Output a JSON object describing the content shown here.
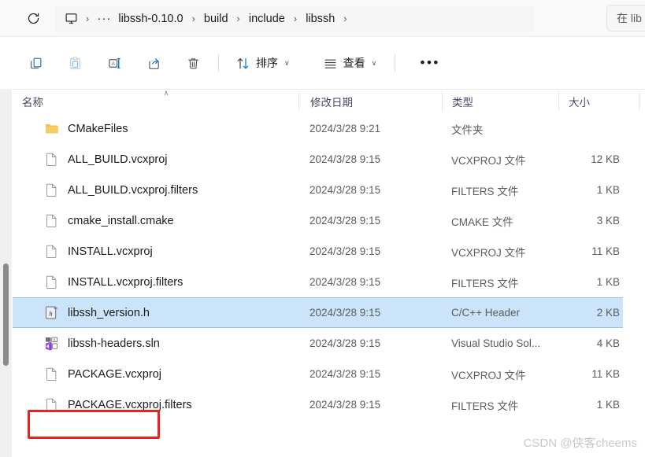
{
  "addressbar": {
    "refresh_icon": "refresh-icon",
    "pc_icon": "this-pc-icon",
    "overflow_label": "···",
    "separator": "›",
    "crumbs": [
      "libssh-0.10.0",
      "build",
      "include",
      "libssh"
    ],
    "trailing_separator": "›",
    "search_placeholder": "在 lib"
  },
  "toolbar": {
    "icon_buttons": [
      {
        "name": "copy-icon",
        "title": "复制"
      },
      {
        "name": "paste-icon",
        "title": "粘贴"
      },
      {
        "name": "rename-icon",
        "title": "重命名"
      },
      {
        "name": "share-icon",
        "title": "共享"
      },
      {
        "name": "delete-icon",
        "title": "删除"
      }
    ],
    "sort_label": "排序",
    "sort_icon": "sort-arrows-icon",
    "view_label": "查看",
    "view_icon": "view-list-icon",
    "more_label": "•••",
    "chevron": "∨"
  },
  "columns": {
    "name": "名称",
    "date": "修改日期",
    "type": "类型",
    "size": "大小",
    "sort_caret": "∧"
  },
  "files": [
    {
      "name": "CMakeFiles",
      "date": "2024/3/28 9:21",
      "type": "文件夹",
      "size": "",
      "icon": "folder-icon",
      "selected": false
    },
    {
      "name": "ALL_BUILD.vcxproj",
      "date": "2024/3/28 9:15",
      "type": "VCXPROJ 文件",
      "size": "12 KB",
      "icon": "file-icon",
      "selected": false
    },
    {
      "name": "ALL_BUILD.vcxproj.filters",
      "date": "2024/3/28 9:15",
      "type": "FILTERS 文件",
      "size": "1 KB",
      "icon": "file-icon",
      "selected": false
    },
    {
      "name": "cmake_install.cmake",
      "date": "2024/3/28 9:15",
      "type": "CMAKE 文件",
      "size": "3 KB",
      "icon": "file-icon",
      "selected": false
    },
    {
      "name": "INSTALL.vcxproj",
      "date": "2024/3/28 9:15",
      "type": "VCXPROJ 文件",
      "size": "11 KB",
      "icon": "file-icon",
      "selected": false
    },
    {
      "name": "INSTALL.vcxproj.filters",
      "date": "2024/3/28 9:15",
      "type": "FILTERS 文件",
      "size": "1 KB",
      "icon": "file-icon",
      "selected": false
    },
    {
      "name": "libssh_version.h",
      "date": "2024/3/28 9:15",
      "type": "C/C++ Header",
      "size": "2 KB",
      "icon": "cpp-header-icon",
      "selected": true
    },
    {
      "name": "libssh-headers.sln",
      "date": "2024/3/28 9:15",
      "type": "Visual Studio Sol...",
      "size": "4 KB",
      "icon": "vs-solution-icon",
      "selected": false
    },
    {
      "name": "PACKAGE.vcxproj",
      "date": "2024/3/28 9:15",
      "type": "VCXPROJ 文件",
      "size": "11 KB",
      "icon": "file-icon",
      "selected": false
    },
    {
      "name": "PACKAGE.vcxproj.filters",
      "date": "2024/3/28 9:15",
      "type": "FILTERS 文件",
      "size": "1 KB",
      "icon": "file-icon",
      "selected": false
    }
  ],
  "annotation": {
    "shape": "rectangle",
    "color": "#f02020",
    "target": "libssh_version.h"
  },
  "watermark": "CSDN @侠客cheems",
  "colors": {
    "selection_fill": "#cbe4f9",
    "selection_border": "#8cc5f0",
    "annotation_red": "#f02020",
    "accent_blue": "#0a7cd4",
    "folder_yellow": "#f5c04b",
    "header_text": "#444b66"
  }
}
